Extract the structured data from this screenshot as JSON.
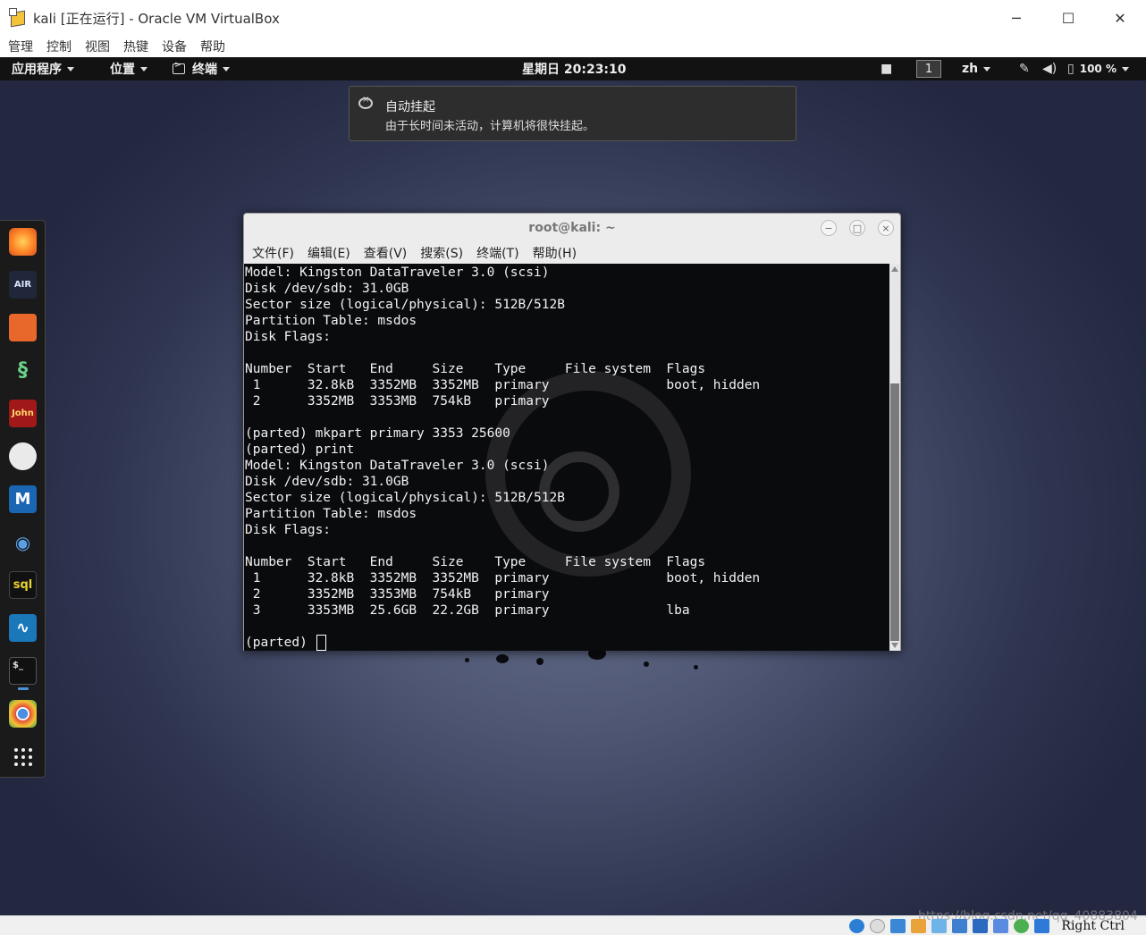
{
  "vbox": {
    "title": "kali [正在运行] - Oracle VM VirtualBox",
    "menu": [
      "管理",
      "控制",
      "视图",
      "热键",
      "设备",
      "帮助"
    ],
    "minimize": "─",
    "maximize": "☐",
    "close": "✕",
    "host_key": "Right Ctrl",
    "watermark": "https://blog.csdn.net/qq_40883804"
  },
  "topbar": {
    "apps": "应用程序",
    "places": "位置",
    "terminal": "终端",
    "clock": "星期日 20:23:10",
    "workspace": "1",
    "language": "zh",
    "battery": "100 %"
  },
  "notification": {
    "title": "自动挂起",
    "body": "由于长时间未活动，计算机将很快挂起。"
  },
  "dock": {
    "items": [
      "firefox",
      "aircrack",
      "burpsuite",
      "hydra",
      "john",
      "maltego",
      "metasploit",
      "eye",
      "sqlmap",
      "wireshark",
      "terminal",
      "chrome",
      "app-grid"
    ],
    "air_label": "AIR",
    "john_label": "John",
    "sql_label": "sql",
    "term_label": "$_",
    "meta_label": "M",
    "hydra_label": "§",
    "shark_label": "∿",
    "eye_label": "◉"
  },
  "terminal": {
    "title": "root@kali: ~",
    "menu": [
      "文件(F)",
      "编辑(E)",
      "查看(V)",
      "搜索(S)",
      "终端(T)",
      "帮助(H)"
    ],
    "lines": [
      "Model: Kingston DataTraveler 3.0 (scsi)",
      "Disk /dev/sdb: 31.0GB",
      "Sector size (logical/physical): 512B/512B",
      "Partition Table: msdos",
      "Disk Flags:",
      "",
      "Number  Start   End     Size    Type     File system  Flags",
      " 1      32.8kB  3352MB  3352MB  primary               boot, hidden",
      " 2      3352MB  3353MB  754kB   primary",
      "",
      "(parted) mkpart primary 3353 25600",
      "(parted) print",
      "Model: Kingston DataTraveler 3.0 (scsi)",
      "Disk /dev/sdb: 31.0GB",
      "Sector size (logical/physical): 512B/512B",
      "Partition Table: msdos",
      "Disk Flags:",
      "",
      "Number  Start   End     Size    Type     File system  Flags",
      " 1      32.8kB  3352MB  3352MB  primary               boot, hidden",
      " 2      3352MB  3353MB  754kB   primary",
      " 3      3353MB  25.6GB  22.2GB  primary               lba",
      ""
    ],
    "prompt": "(parted) "
  },
  "colors": {
    "topbar_bg": "#121212",
    "terminal_bg": "#0a0b0d",
    "terminal_fg": "#f2f2f2"
  }
}
